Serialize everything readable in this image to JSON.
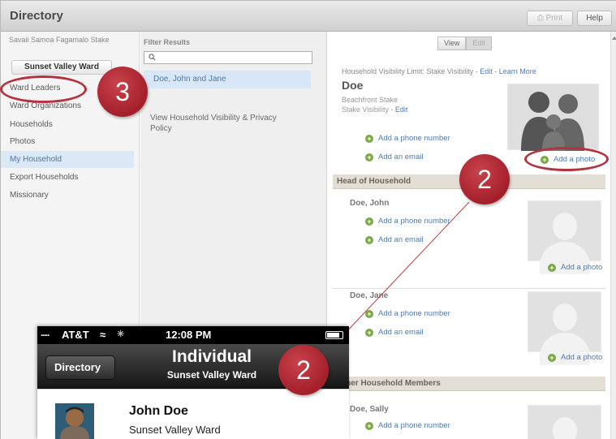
{
  "app": {
    "title": "Directory",
    "print_label": "Print",
    "help_label": "Help"
  },
  "left": {
    "stake": "Savaii Samoa Fagamalo Stake",
    "ward": "Sunset Valley Ward",
    "items": [
      {
        "label": "Ward Leaders"
      },
      {
        "label": "Ward Organizations"
      },
      {
        "label": "Households"
      },
      {
        "label": "Photos"
      },
      {
        "label": "My Household"
      },
      {
        "label": "Export Households"
      },
      {
        "label": "Missionary"
      }
    ]
  },
  "middle": {
    "filter_label": "Filter Results",
    "search_value": "",
    "result": "Doe, John and Jane",
    "privacy_link": "View Household Visibility & Privacy Policy"
  },
  "right": {
    "view_label": "View",
    "edit_label": "Edit",
    "visibility_prefix": "Household Visibility Limit: Stake Visibility - ",
    "visibility_edit": "Edit",
    "visibility_sep": " - ",
    "visibility_learn": "Learn More",
    "family_name": "Doe",
    "family_stake": "Beachfront Stake",
    "family_visibility_prefix": "Stake Visibility - ",
    "family_visibility_edit": "Edit",
    "add_phone": "Add a phone number",
    "add_email": "Add an email",
    "add_photo": "Add a photo",
    "section_head": "Head of Household",
    "section_other": "Other Household Members",
    "persons": [
      "Doe, John",
      "Doe, Jane",
      "Doe, Sally"
    ]
  },
  "annotations": {
    "badge_ward_leaders": "3",
    "badge_add_photo": "2",
    "badge_phone": "2"
  },
  "phone": {
    "carrier": "AT&T",
    "time": "12:08 PM",
    "back_label": "Directory",
    "title": "Individual",
    "subtitle": "Sunset Valley Ward",
    "person_name": "John Doe",
    "person_ward": "Sunset Valley Ward"
  },
  "colors": {
    "accent": "#4d7bb1",
    "badge": "#b3333e",
    "add": "#7ba843"
  }
}
